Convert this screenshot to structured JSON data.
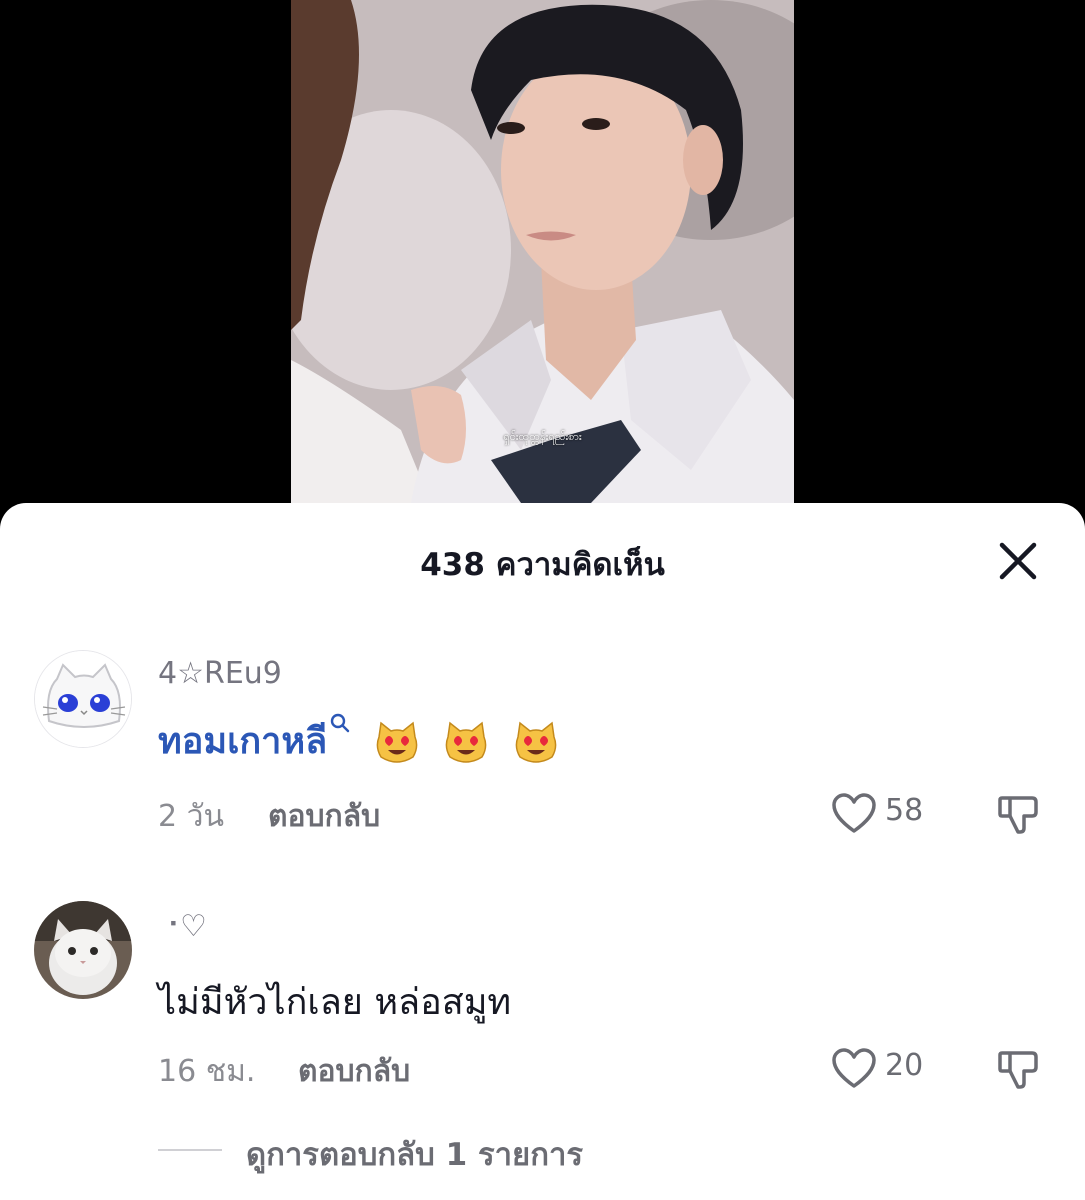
{
  "video": {
    "caption": "ရှင်းထုတ္တန်းရည်းစား"
  },
  "sheet": {
    "title": "438 ความคิดเห็น",
    "close_icon": "close-icon"
  },
  "comments": [
    {
      "username": "4☆REu9",
      "keyword_link": "ทอมเกาหลี",
      "emoji": "heart-eyes-cat-emoji",
      "emoji_count": 3,
      "time": "2 วัน",
      "reply_label": "ตอบกลับ",
      "likes": "58",
      "avatar_icon": "white-cat-cartoon-avatar"
    },
    {
      "username": "⠐♡",
      "text": "ไม่มีหัวไก่เลย หล่อสมูท",
      "time": "16 ชม.",
      "reply_label": "ตอบกลับ",
      "likes": "20",
      "avatar_icon": "white-cat-photo-avatar"
    }
  ],
  "view_replies": {
    "label": "ดูการตอบกลับ 1 รายการ"
  },
  "colors": {
    "link": "#2b57b6",
    "text": "#161823",
    "muted": "#8a8b91"
  }
}
